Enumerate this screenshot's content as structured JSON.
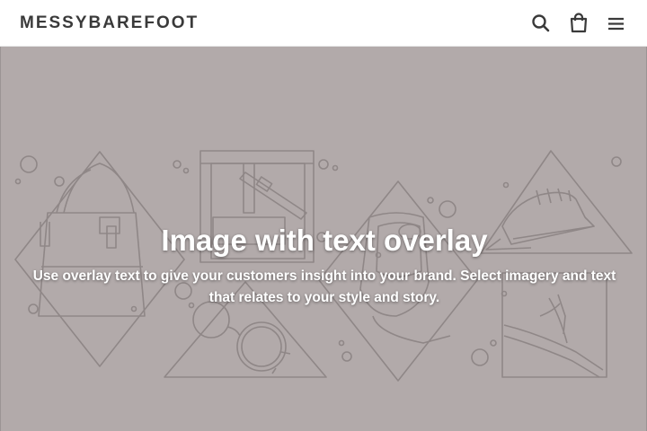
{
  "header": {
    "logo": "MESSYBAREFOOT",
    "icons": [
      "search-icon",
      "cart-icon",
      "menu-icon"
    ]
  },
  "hero": {
    "title": "Image with text overlay",
    "subtitle": "Use overlay text to give your customers insight into your brand. Select imagery and text that relates to your style and story."
  },
  "colors": {
    "header_bg": "#ffffff",
    "logo": "#3a3a3a",
    "hero_bg": "#b2aaaa",
    "hero_lines": "#8f8787",
    "hero_text": "#ffffff"
  }
}
